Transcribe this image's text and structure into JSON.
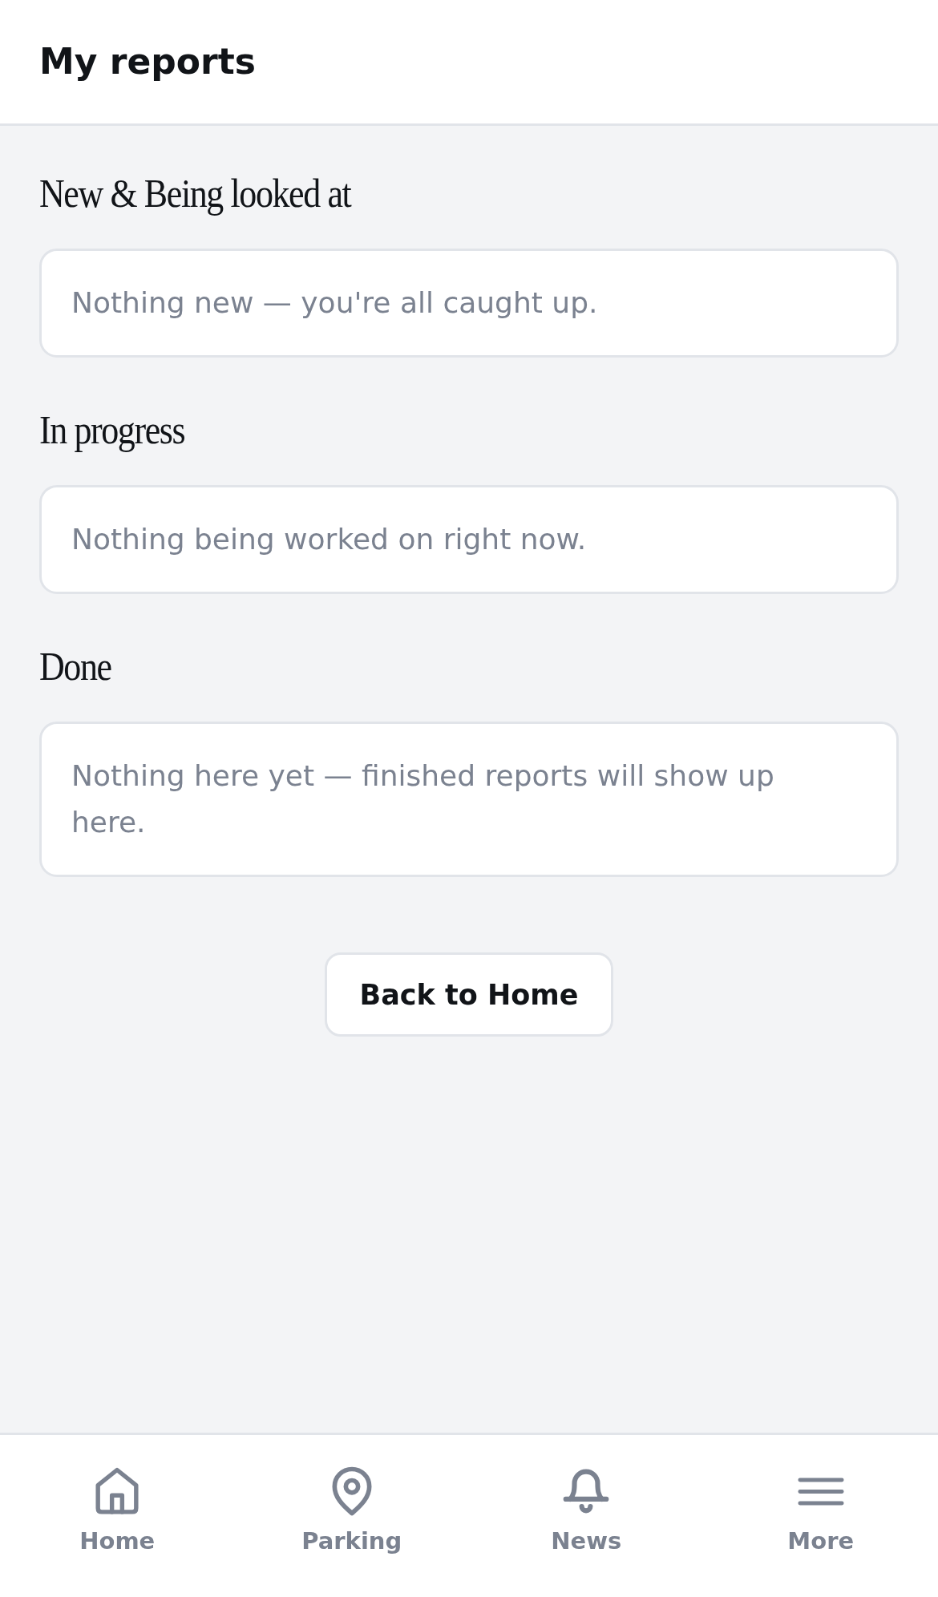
{
  "header": {
    "title": "My reports"
  },
  "sections": [
    {
      "heading": "New & Being looked at",
      "empty_message": "Nothing new — you're all caught up."
    },
    {
      "heading": "In progress",
      "empty_message": "Nothing being worked on right now."
    },
    {
      "heading": "Done",
      "empty_message": "Nothing here yet — finished reports will show up here."
    }
  ],
  "back_button": {
    "label": "Back to Home"
  },
  "bottom_nav": [
    {
      "label": "Home",
      "selected": false
    },
    {
      "label": "Parking",
      "selected": false
    },
    {
      "label": "News",
      "selected": false
    },
    {
      "label": "More",
      "selected": false
    }
  ]
}
